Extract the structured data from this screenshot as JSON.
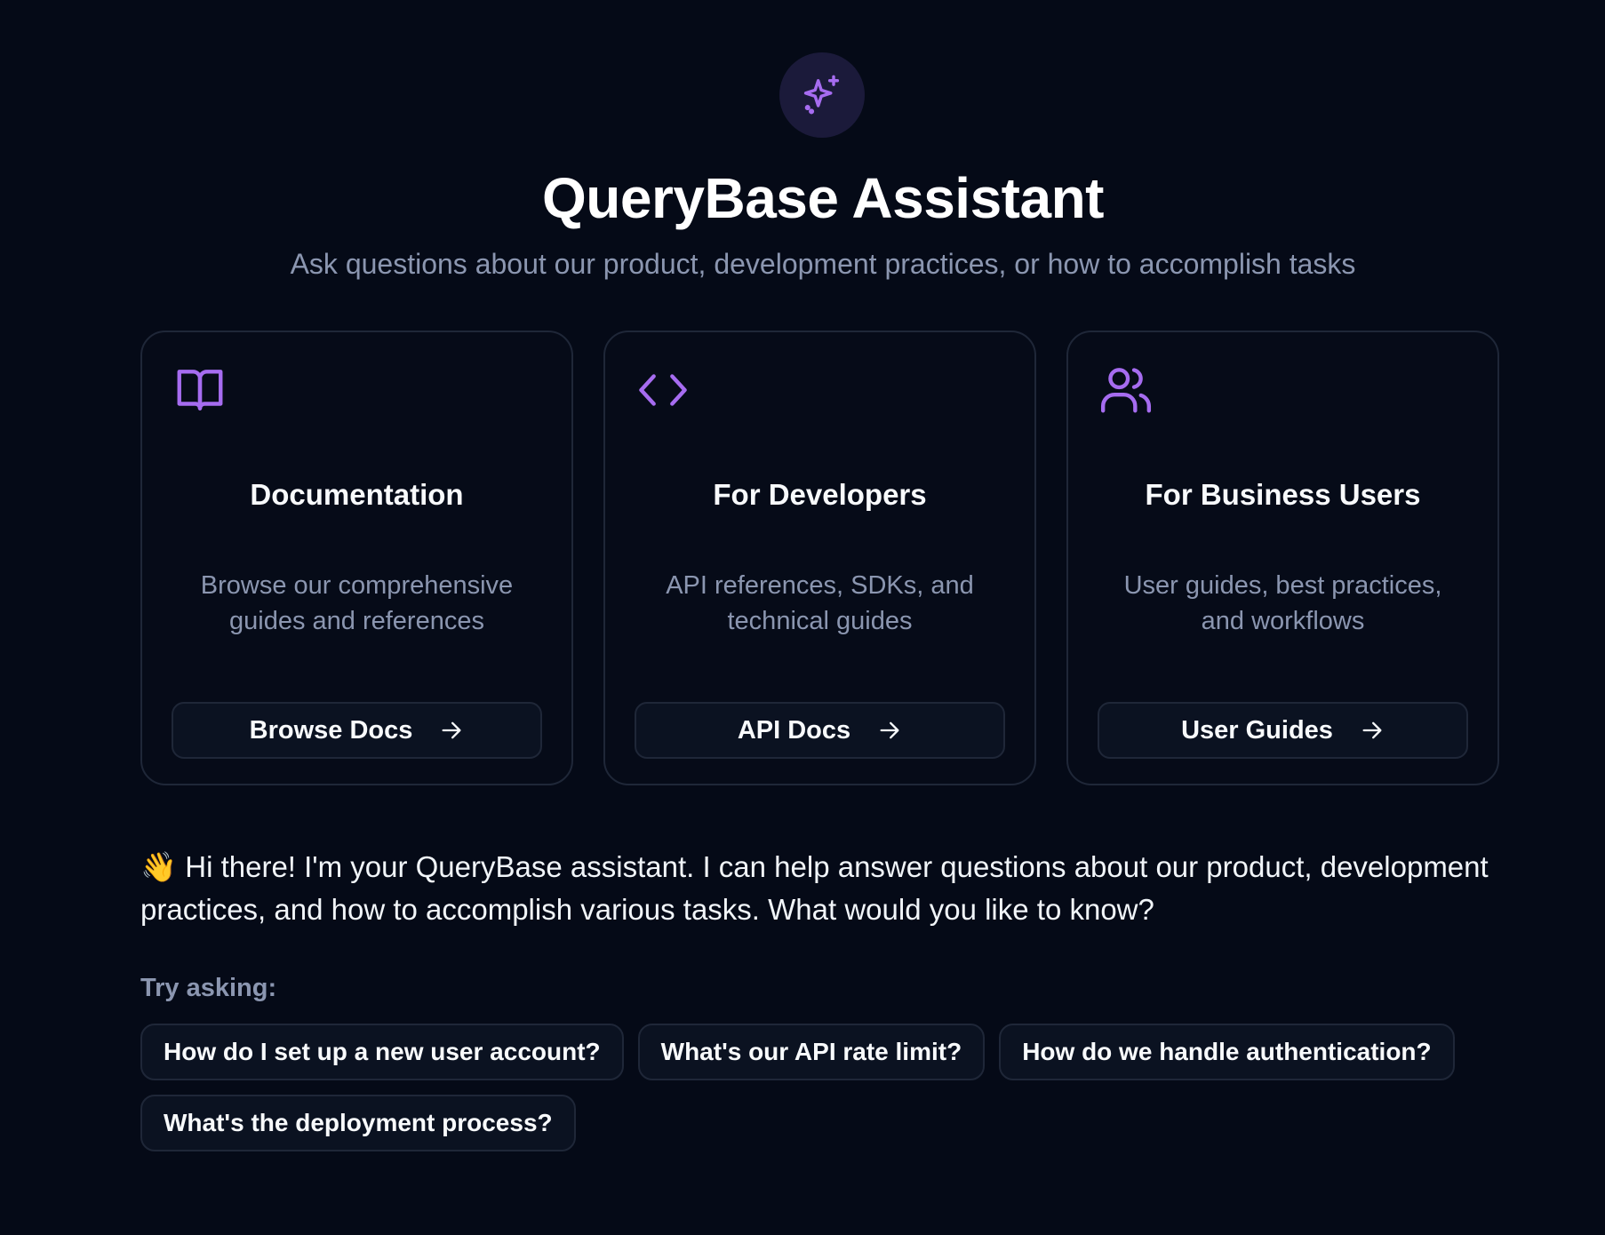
{
  "header": {
    "icon": "sparkles-icon",
    "title": "QueryBase Assistant",
    "subtitle": "Ask questions about our product, development practices, or how to accomplish tasks"
  },
  "cards": [
    {
      "icon": "book-open-icon",
      "title": "Documentation",
      "description": "Browse our comprehensive guides and references",
      "button_label": "Browse Docs"
    },
    {
      "icon": "code-icon",
      "title": "For Developers",
      "description": "API references, SDKs, and technical guides",
      "button_label": "API Docs"
    },
    {
      "icon": "users-icon",
      "title": "For Business Users",
      "description": "User guides, best practices, and workflows",
      "button_label": "User Guides"
    }
  ],
  "greeting": "👋 Hi there! I'm your QueryBase assistant. I can help answer questions about our product, development practices, and how to accomplish various tasks. What would you like to know?",
  "suggestions": {
    "label": "Try asking:",
    "items": [
      "How do I set up a new user account?",
      "What's our API rate limit?",
      "How do we handle authentication?",
      "What's the deployment process?"
    ]
  },
  "colors": {
    "background": "#050a17",
    "accent": "#a66cf0",
    "muted_text": "#8b96b0",
    "border": "#1f2738"
  }
}
